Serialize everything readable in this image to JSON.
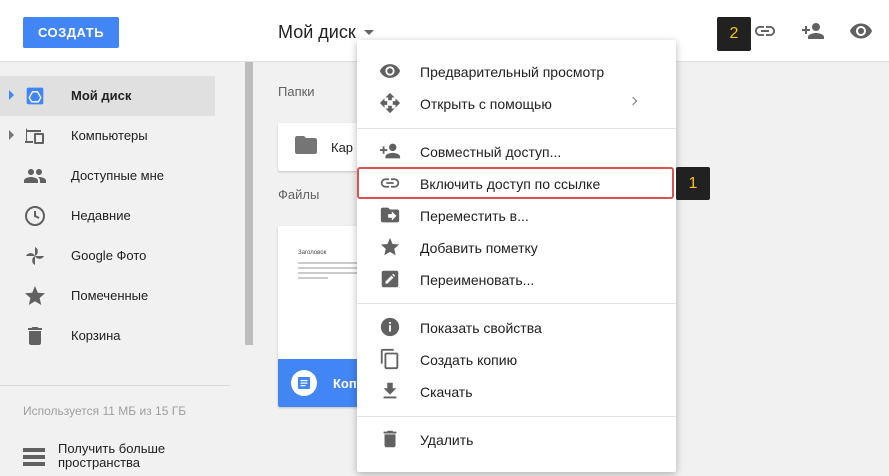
{
  "header": {
    "create_label": "СОЗДАТЬ",
    "drive_title": "Мой диск",
    "badge_two": "2",
    "icons": [
      "link-icon",
      "person-add-icon",
      "eye-icon"
    ]
  },
  "sidebar": {
    "items": [
      {
        "label": "Мой диск",
        "icon": "drive-icon",
        "active": true
      },
      {
        "label": "Компьютеры",
        "icon": "computer-icon"
      },
      {
        "label": "Доступные мне",
        "icon": "people-icon"
      },
      {
        "label": "Недавние",
        "icon": "clock-icon"
      },
      {
        "label": "Google Фото",
        "icon": "pinwheel-icon"
      },
      {
        "label": "Помеченные",
        "icon": "star-icon"
      },
      {
        "label": "Корзина",
        "icon": "trash-icon"
      }
    ],
    "storage_text": "Используется 11 МБ из 15 ГБ",
    "upgrade_label": "Получить больше пространства"
  },
  "main": {
    "folders_title": "Папки",
    "folder_label": "Кар",
    "files_title": "Файлы",
    "file_label": "Копи",
    "doc_heading": "Заголовок"
  },
  "menu": {
    "items": [
      {
        "label": "Предварительный просмотр",
        "icon": "eye-icon"
      },
      {
        "label": "Открыть с помощью",
        "icon": "move-arrows-icon",
        "submenu": true
      },
      {
        "label": "Совместный доступ...",
        "icon": "person-add-icon"
      },
      {
        "label": "Включить доступ по ссылке",
        "icon": "link-icon"
      },
      {
        "label": "Переместить в...",
        "icon": "folder-move-icon"
      },
      {
        "label": "Добавить пометку",
        "icon": "star-icon"
      },
      {
        "label": "Переименовать...",
        "icon": "pencil-icon"
      },
      {
        "label": "Показать свойства",
        "icon": "info-icon"
      },
      {
        "label": "Создать копию",
        "icon": "copy-icon"
      },
      {
        "label": "Скачать",
        "icon": "download-icon"
      },
      {
        "label": "Удалить",
        "icon": "trash-icon"
      }
    ],
    "badge_one": "1"
  },
  "colors": {
    "accent": "#4285f4",
    "highlight": "#d9534f",
    "badge_bg": "#212121",
    "badge_text": "#f5c518"
  }
}
